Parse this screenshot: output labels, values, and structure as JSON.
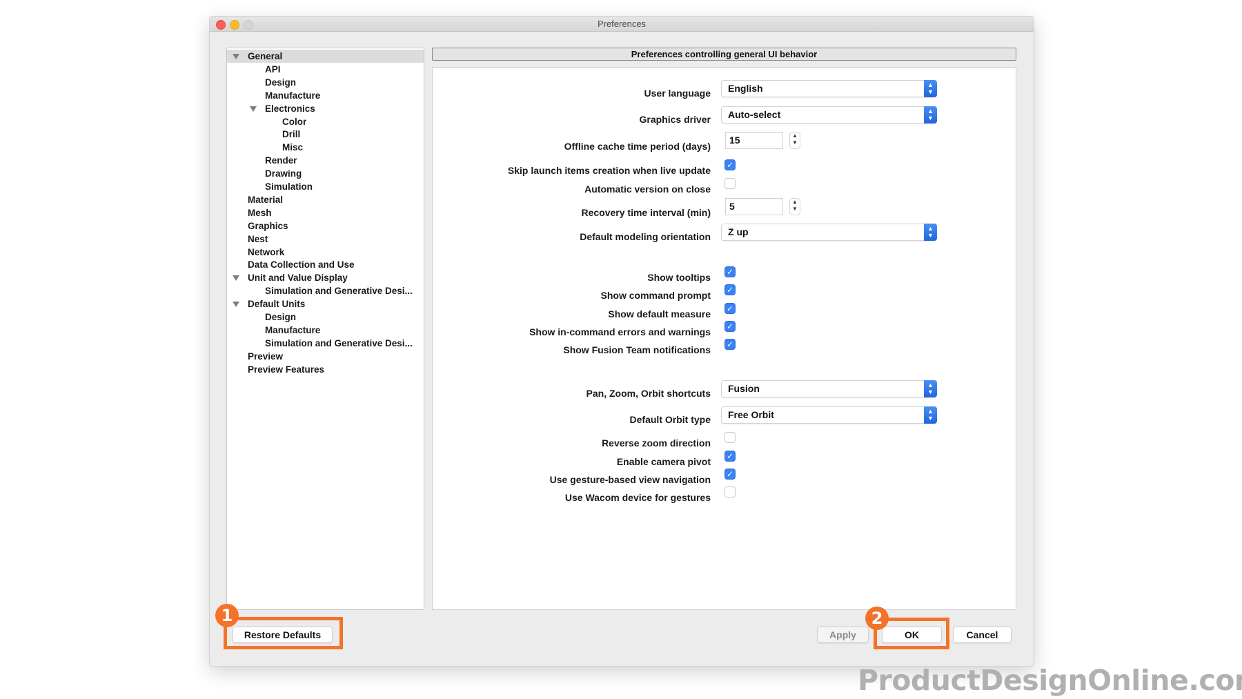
{
  "window": {
    "title": "Preferences"
  },
  "tree": {
    "items": [
      {
        "label": "General",
        "level": 0,
        "expanded": true,
        "selected": true
      },
      {
        "label": "API",
        "level": 1
      },
      {
        "label": "Design",
        "level": 1
      },
      {
        "label": "Manufacture",
        "level": 1
      },
      {
        "label": "Electronics",
        "level": 1,
        "expanded": true
      },
      {
        "label": "Color",
        "level": 2
      },
      {
        "label": "Drill",
        "level": 2
      },
      {
        "label": "Misc",
        "level": 2
      },
      {
        "label": "Render",
        "level": 1
      },
      {
        "label": "Drawing",
        "level": 1
      },
      {
        "label": "Simulation",
        "level": 1
      },
      {
        "label": "Material",
        "level": 0
      },
      {
        "label": "Mesh",
        "level": 0
      },
      {
        "label": "Graphics",
        "level": 0
      },
      {
        "label": "Nest",
        "level": 0
      },
      {
        "label": "Network",
        "level": 0
      },
      {
        "label": "Data Collection and Use",
        "level": 0
      },
      {
        "label": "Unit and Value Display",
        "level": 0,
        "expanded": true
      },
      {
        "label": "Simulation and Generative Desi...",
        "level": 1
      },
      {
        "label": "Default Units",
        "level": 0,
        "expanded": true
      },
      {
        "label": "Design",
        "level": 1
      },
      {
        "label": "Manufacture",
        "level": 1
      },
      {
        "label": "Simulation and Generative Desi...",
        "level": 1
      },
      {
        "label": "Preview",
        "level": 0
      },
      {
        "label": "Preview Features",
        "level": 0
      }
    ]
  },
  "panel": {
    "header": "Preferences controlling general UI behavior",
    "settings": {
      "user_language": {
        "label": "User language",
        "value": "English"
      },
      "graphics_driver": {
        "label": "Graphics driver",
        "value": "Auto-select"
      },
      "offline_cache": {
        "label": "Offline cache time period (days)",
        "value": "15"
      },
      "skip_launch": {
        "label": "Skip launch items creation when live update",
        "checked": true
      },
      "auto_version": {
        "label": "Automatic version on close",
        "checked": false
      },
      "recovery_interval": {
        "label": "Recovery time interval (min)",
        "value": "5"
      },
      "modeling_orientation": {
        "label": "Default modeling orientation",
        "value": "Z up"
      },
      "show_tooltips": {
        "label": "Show tooltips",
        "checked": true
      },
      "show_command_prompt": {
        "label": "Show command prompt",
        "checked": true
      },
      "show_default_measure": {
        "label": "Show default measure",
        "checked": true
      },
      "show_errors": {
        "label": "Show in-command errors and warnings",
        "checked": true
      },
      "show_fusion_team": {
        "label": "Show Fusion Team notifications",
        "checked": true
      },
      "pzo_shortcuts": {
        "label": "Pan, Zoom, Orbit shortcuts",
        "value": "Fusion"
      },
      "orbit_type": {
        "label": "Default Orbit type",
        "value": "Free Orbit"
      },
      "reverse_zoom": {
        "label": "Reverse zoom direction",
        "checked": false
      },
      "camera_pivot": {
        "label": "Enable camera pivot",
        "checked": true
      },
      "gesture_nav": {
        "label": "Use gesture-based view navigation",
        "checked": true
      },
      "wacom": {
        "label": "Use Wacom device for gestures",
        "checked": false
      }
    }
  },
  "buttons": {
    "restore_defaults": "Restore Defaults",
    "apply": "Apply",
    "ok": "OK",
    "cancel": "Cancel"
  },
  "annotations": {
    "badge1": "1",
    "badge2": "2",
    "highlight_color": "#f4732a"
  },
  "icons": {
    "check": "✓",
    "stepper": "⌃⌄",
    "select_caret": "⌃⌄"
  },
  "watermark": "ProductDesignOnline.com"
}
